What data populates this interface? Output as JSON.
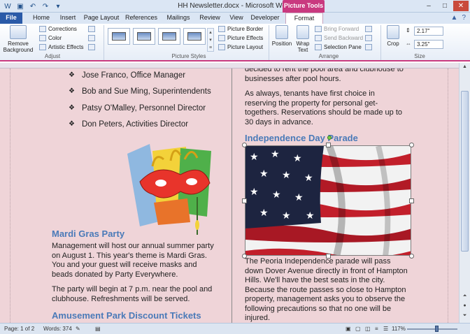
{
  "window": {
    "title": "HH Newsletter.docx - Microsoft Word",
    "context_tab": "Picture Tools",
    "controls": [
      "–",
      "□",
      "✕"
    ]
  },
  "tabs": [
    "File",
    "Home",
    "Insert",
    "Page Layout",
    "References",
    "Mailings",
    "Review",
    "View",
    "Developer",
    "Format"
  ],
  "ribbon": {
    "adjust": {
      "label": "Adjust",
      "remove_background": "Remove Background",
      "corrections": "Corrections",
      "color": "Color",
      "artistic_effects": "Artistic Effects"
    },
    "picture_styles": {
      "label": "Picture Styles",
      "border": "Picture Border",
      "effects": "Picture Effects",
      "layout": "Picture Layout"
    },
    "arrange": {
      "label": "Arrange",
      "position": "Position",
      "wrap_text": "Wrap Text",
      "bring_forward": "Bring Forward",
      "send_backward": "Send Backward",
      "selection_pane": "Selection Pane"
    },
    "size": {
      "label": "Size",
      "crop": "Crop",
      "height": "2.17\"",
      "width": "3.25\""
    }
  },
  "document": {
    "bullets": [
      "Jose Franco, Office Manager",
      "Bob and Sue Ming, Superintendents",
      "Patsy O'Malley, Personnel Director",
      "Don Peters, Activities Director"
    ],
    "mardi_gras_heading": "Mardi Gras Party",
    "mardi_gras_p1": [
      "Management will host our annual summer party",
      "on August 1. This year's theme is Mardi Gras.",
      "You and your guest will receive masks and",
      "beads donated by Party Everywhere."
    ],
    "mardi_gras_p2": [
      "The party will begin at 7 p.m. near the pool and",
      "clubhouse. Refreshments will be served."
    ],
    "amusement_heading": "Amusement Park Discount Tickets",
    "right_p1": [
      "decided to rent the pool area and clubhouse to",
      "businesses after pool hours."
    ],
    "right_p2": [
      "As always, tenants have first choice in",
      "reserving the property for personal get-",
      "togethers. Reservations should be made up to",
      "30 days in advance."
    ],
    "independence_heading": "Independence Day Parade",
    "right_p3": [
      "The Peoria Independence parade will pass",
      "down Dover Avenue directly in front of Hampton",
      "Hills. We'll have the best seats in the city.",
      "Because the route passes so close to Hampton",
      "property, management asks you to observe the",
      "following precautions so that no one will be",
      "injured."
    ]
  },
  "status": {
    "page": "Page: 1 of 2",
    "words": "Words: 374",
    "zoom": "117%"
  }
}
